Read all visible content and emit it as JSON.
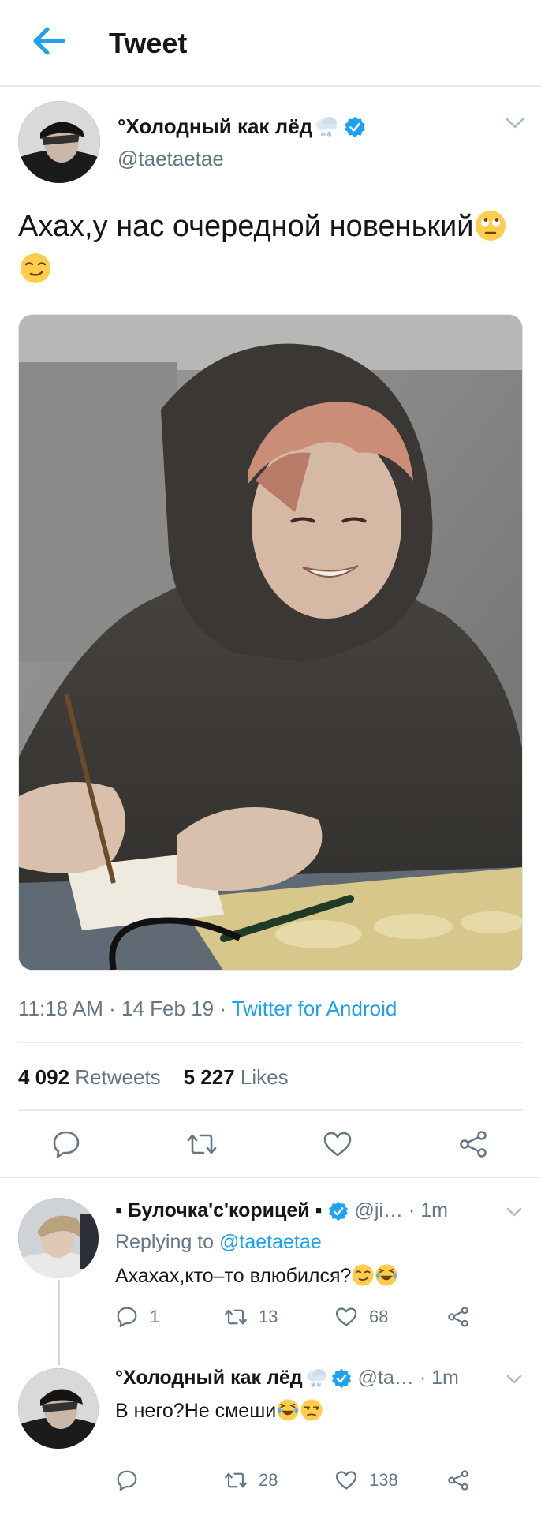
{
  "header": {
    "title": "Tweet",
    "back_icon": "arrow-left-icon"
  },
  "tweet": {
    "display_name": "°Холодный как лёд",
    "handle": "@taetaetae",
    "text": "Ахах,у нас очередной новенький",
    "time": "11:18 AM · 14 Feb 19 · ",
    "source": "Twitter for Android",
    "retweets": "4 092",
    "retweets_label": " Retweets",
    "likes": "5 227",
    "likes_label": " Likes"
  },
  "replies": [
    {
      "display_name": "▪ Булочка'с'корицей ▪",
      "handle": "@ji… · 1m",
      "replying_prefix": "Replying to ",
      "replying_to": "@taetaetae",
      "text": "Ахахах,кто–то влюбился?",
      "reply_count": "1",
      "retweet_count": "13",
      "like_count": "68"
    },
    {
      "display_name": "°Холодный как лёд",
      "handle": "@ta… · 1m",
      "text": "В него?Не смеши",
      "reply_count": "",
      "retweet_count": "28",
      "like_count": "138"
    }
  ],
  "colors": {
    "accent": "#1da1f2",
    "secondary_text": "#657786",
    "divider": "#e6ecf0"
  }
}
